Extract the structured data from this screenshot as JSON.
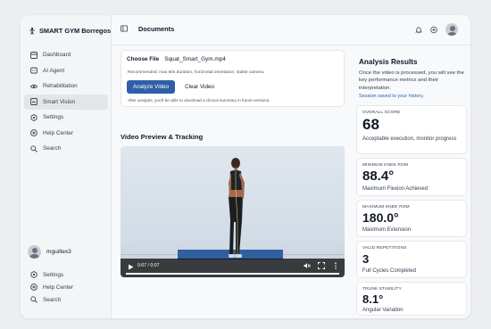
{
  "app": {
    "brand": "SMART GYM Borregos",
    "brand_icon": "dumbbell-figure-icon"
  },
  "sidebar": {
    "items": [
      {
        "label": "Dashboard",
        "icon": "dashboard-icon",
        "active": false
      },
      {
        "label": "AI Agent",
        "icon": "ai-agent-icon",
        "active": false
      },
      {
        "label": "Rehabilitation",
        "icon": "eye-icon",
        "active": false
      },
      {
        "label": "Smart Vision",
        "icon": "smart-vision-icon",
        "active": true
      },
      {
        "label": "Settings",
        "icon": "gear-icon",
        "active": false
      },
      {
        "label": "Help Center",
        "icon": "help-icon",
        "active": false
      },
      {
        "label": "Search",
        "icon": "search-icon",
        "active": false
      }
    ],
    "user": {
      "name": "mguillex3"
    },
    "bottom_items": [
      {
        "label": "Settings",
        "icon": "gear-icon"
      },
      {
        "label": "Help Center",
        "icon": "help-icon"
      },
      {
        "label": "Search",
        "icon": "search-icon"
      }
    ]
  },
  "topbar": {
    "title": "Documents"
  },
  "upload": {
    "choose_label": "Choose File",
    "file_name": "Squat_Smart_Gym.mp4",
    "recommendation": "Recommended: max 60s duration, horizontal orientation, stable camera.",
    "analyze_label": "Analyze Video",
    "clear_label": "Clear Video",
    "after_note": "After analysis, you'll be able to download a clinical summary in future versions."
  },
  "video": {
    "section_title": "Video Preview & Tracking",
    "time": "0:07 / 0:07",
    "progress": 1.0
  },
  "results": {
    "title": "Analysis Results",
    "description": "Once the video is processed, you will see the key performance metrics and their interpretation.",
    "saved_note": "Session saved to your history.",
    "metrics": [
      {
        "label": "OVERALL SCORE",
        "value": "68",
        "sub": "Acceptable execution, monitor progress"
      },
      {
        "label": "MINIMUM KNEE ROM",
        "value": "88.4°",
        "sub": "Maximum Flexion Achieved"
      },
      {
        "label": "MAXIMUM KNEE ROM",
        "value": "180.0°",
        "sub": "Maximum Extension"
      },
      {
        "label": "VALID REPETITIONS",
        "value": "3",
        "sub": "Full Cycles Completed"
      },
      {
        "label": "TRUNK STABILITY",
        "value": "8.1°",
        "sub": "Angular Variation"
      }
    ]
  },
  "colors": {
    "accent": "#2f5fa8",
    "active_nav": "#e3e5e9",
    "mat": "#2f5f9e"
  }
}
